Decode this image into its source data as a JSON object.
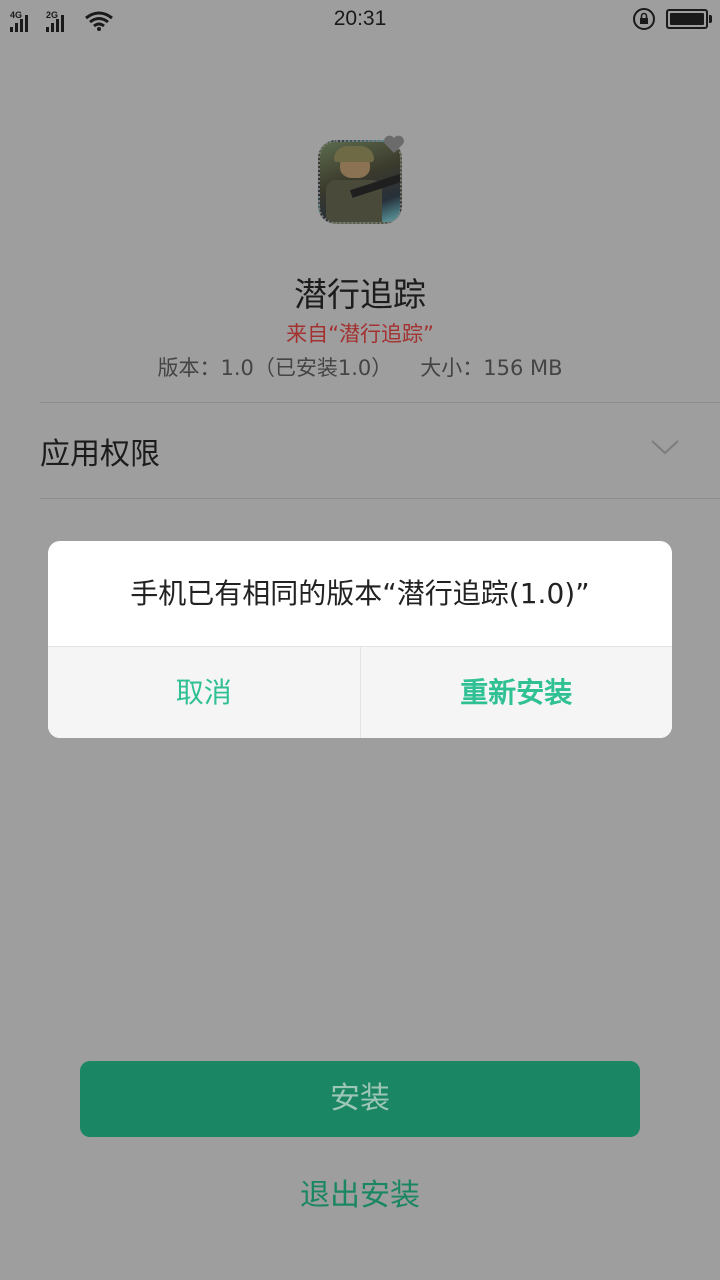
{
  "status_bar": {
    "time": "20:31",
    "sim1_network": "4G",
    "sim2_network": "2G",
    "icons": [
      "signal-icon",
      "wifi-icon",
      "rotation-lock-icon",
      "battery-icon"
    ]
  },
  "app": {
    "name": "潜行追踪",
    "source": "来自“潜行追踪”",
    "version": "版本：1.0（已安装1.0）",
    "size": "大小：156 MB"
  },
  "permissions": {
    "label": "应用权限"
  },
  "dialog": {
    "message": "手机已有相同的版本“潜行追踪(1.0)”",
    "cancel_label": "取消",
    "reinstall_label": "重新安装"
  },
  "actions": {
    "install_label": "安装",
    "exit_label": "退出安装"
  },
  "colors": {
    "accent": "#2fc094",
    "install_button": "#1a8663",
    "source_text": "#a3312f",
    "overlay_background": "#9e9e9e"
  }
}
